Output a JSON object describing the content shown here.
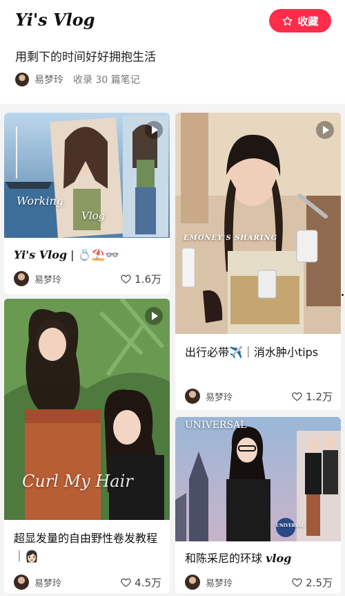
{
  "header": {
    "title": "Yi's Vlog",
    "favorite_label": "收藏",
    "subtitle": "用剩下的时间好好拥抱生活",
    "author": "易梦玲",
    "count": "收录 30 篇笔记"
  },
  "cards": [
    {
      "caption_title": "Yi's Vlog",
      "caption_suffix": "| 💍⛱️👓",
      "author": "易梦玲",
      "likes": "1.6万",
      "overlay": [
        "Working",
        "Vlog"
      ]
    },
    {
      "caption": "出行必带✈️｜消水肿小tips",
      "author": "易梦玲",
      "likes": "1.2万",
      "overlay": [
        "EMONEY'S SHARING"
      ]
    },
    {
      "caption": "超显发量的自由野性卷发教程｜👩🏻",
      "author": "易梦玲",
      "likes": "4.5万",
      "overlay": [
        "Curl My Hair"
      ]
    },
    {
      "caption_text": "和陈采尼的环球",
      "caption_italic": "vlog",
      "author": "易梦玲",
      "likes": "2.5万",
      "overlay": [
        "UNIVERSAL",
        "UNIVERSAL"
      ]
    }
  ],
  "colors": {
    "accent": "#ff2c4a",
    "background": "#f4f4f4"
  },
  "icons": [
    "star-icon",
    "heart-icon",
    "video-icon",
    "avatar"
  ]
}
